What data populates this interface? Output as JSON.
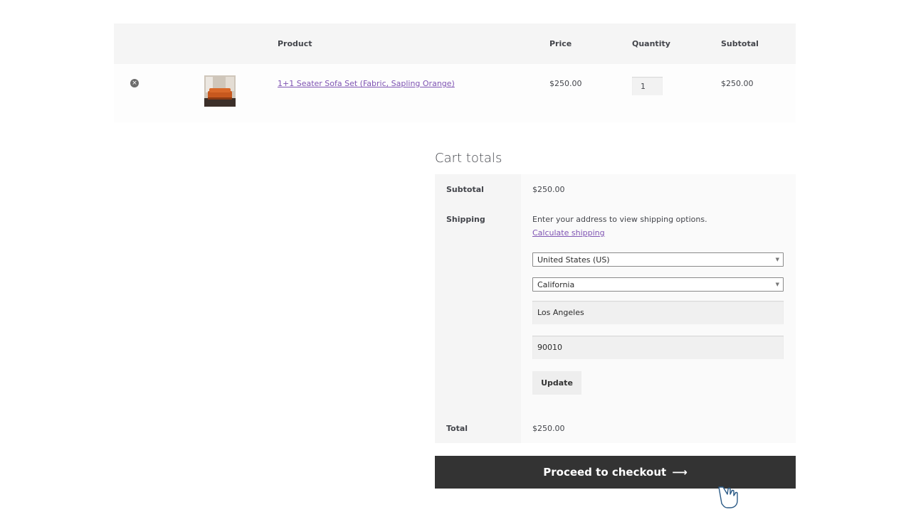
{
  "cart": {
    "headers": {
      "product": "Product",
      "price": "Price",
      "quantity": "Quantity",
      "subtotal": "Subtotal"
    },
    "item": {
      "remove_icon": "×",
      "name": "1+1 Seater Sofa Set (Fabric, Sapling Orange)",
      "price": "$250.00",
      "quantity": "1",
      "subtotal": "$250.00"
    }
  },
  "totals": {
    "title": "Cart totals",
    "subtotal_label": "Subtotal",
    "subtotal_value": "$250.00",
    "shipping_label": "Shipping",
    "shipping_text": "Enter your address to view shipping options.",
    "calculate_link": "Calculate shipping",
    "country": "United States (US)",
    "state": "California",
    "city": "Los Angeles",
    "zip": "90010",
    "update_label": "Update",
    "total_label": "Total",
    "total_value": "$250.00"
  },
  "checkout": {
    "label": "Proceed to checkout",
    "arrow": "⟶"
  },
  "colors": {
    "link": "#7f54b3",
    "button_dark": "#333333"
  }
}
